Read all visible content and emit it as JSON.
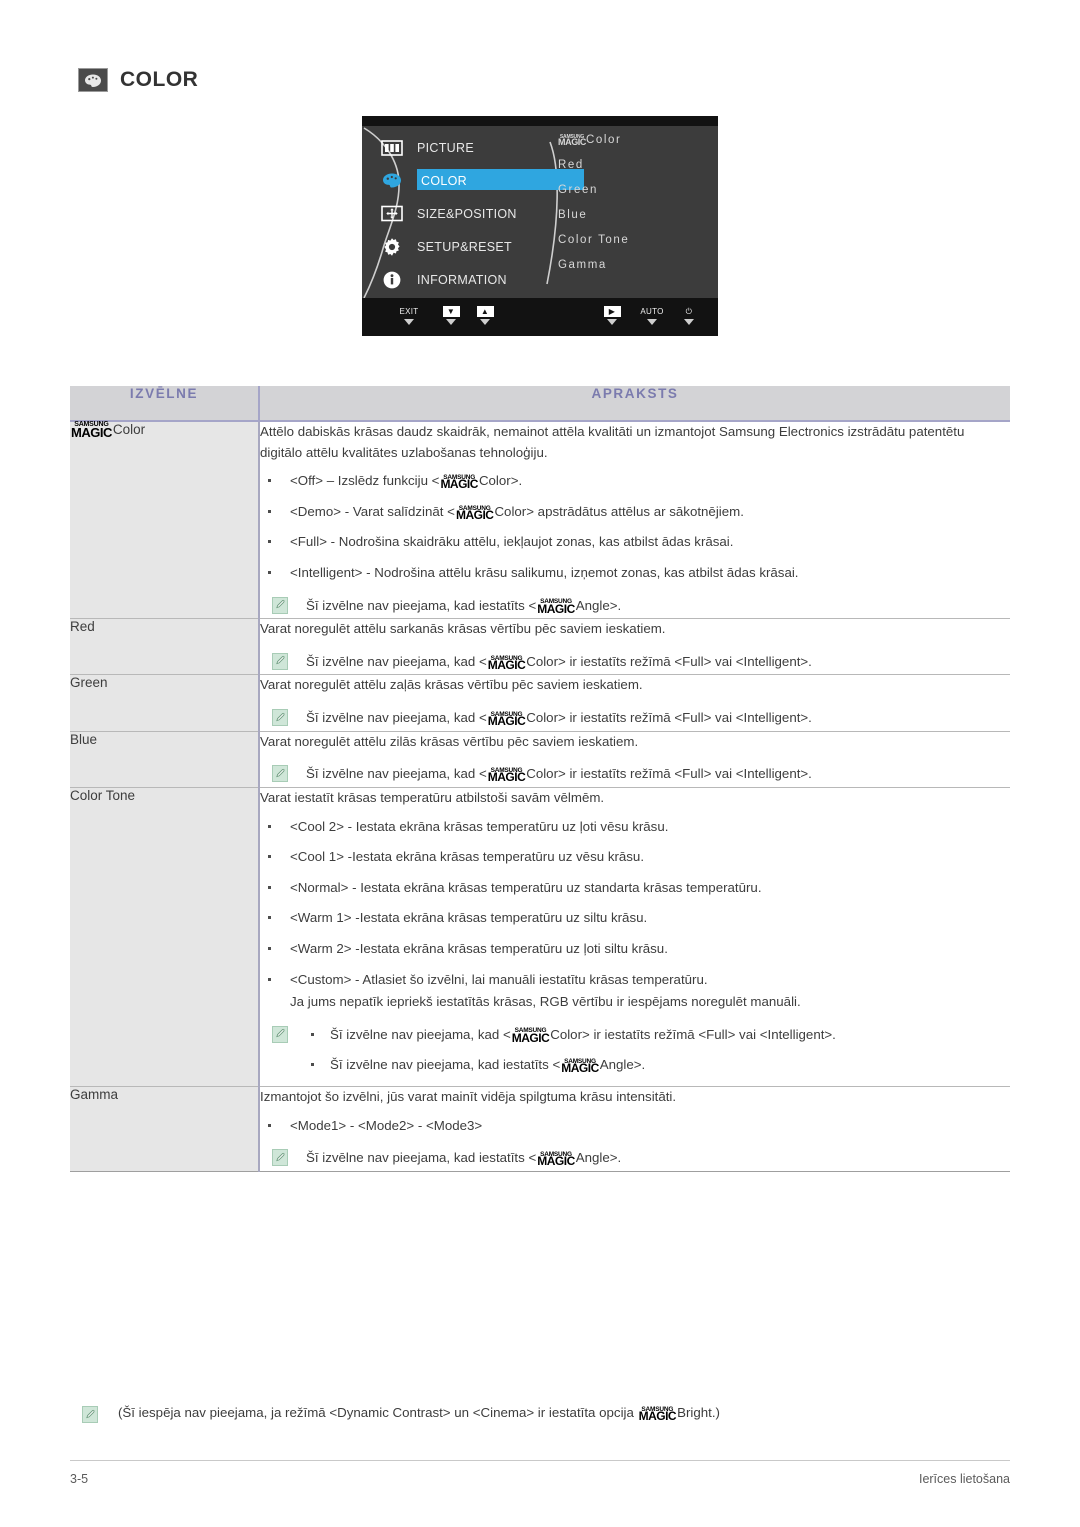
{
  "page": {
    "title": "COLOR",
    "title_icon": "color-palette-icon",
    "footer_page_number": "3-5",
    "footer_section": "Ierīces lietošana"
  },
  "osd": {
    "left_menu": [
      {
        "label": "PICTURE",
        "icon": "picture-icon",
        "selected": false
      },
      {
        "label": "COLOR",
        "icon": "color-palette-icon",
        "selected": true
      },
      {
        "label": "SIZE&POSITION",
        "icon": "size-position-icon",
        "selected": false
      },
      {
        "label": "SETUP&RESET",
        "icon": "gear-icon",
        "selected": false
      },
      {
        "label": "INFORMATION",
        "icon": "info-icon",
        "selected": false
      }
    ],
    "right_items": [
      {
        "prefix_logo": true,
        "label": "Color"
      },
      {
        "prefix_logo": false,
        "label": "Red"
      },
      {
        "prefix_logo": false,
        "label": "Green"
      },
      {
        "prefix_logo": false,
        "label": "Blue"
      },
      {
        "prefix_logo": false,
        "label": "Color Tone"
      },
      {
        "prefix_logo": false,
        "label": "Gamma"
      }
    ],
    "magic_logo": {
      "line1": "SAMSUNG",
      "line2": "MAGIC"
    },
    "bottom_buttons": [
      {
        "label": "EXIT",
        "type": "text"
      },
      {
        "label": "▼",
        "type": "key"
      },
      {
        "label": "▲",
        "type": "key"
      },
      {
        "label": "▶",
        "type": "key"
      },
      {
        "label": "AUTO",
        "type": "text"
      },
      {
        "label": "⏻",
        "type": "power"
      }
    ],
    "highlight_color": "#2fa6e0"
  },
  "table": {
    "header": {
      "menu": "IZVĒLNE",
      "desc": "APRAKSTS"
    },
    "header_text_color": "#7b7bae",
    "rows": [
      {
        "menu_label": "Color",
        "menu_has_logo": true,
        "desc_intro": "Attēlo dabiskās krāsas daudz skaidrāk, nemainot attēla kvalitāti un izmantojot Samsung Electronics izstrādātu patentētu digitālo attēlu kvalitātes uzlabošanas tehnoloģiju.",
        "bullets": [
          {
            "pre": "<Off> – Izslēdz funkciju <",
            "post": "Color>."
          },
          {
            "pre": "<Demo> - Varat salīdzināt <",
            "post": "Color> apstrādātus attēlus ar sākotnējiem."
          },
          {
            "pre": "<Full> - Nodrošina skaidrāku attēlu, iekļaujot zonas, kas atbilst ādas krāsai.",
            "post": ""
          },
          {
            "pre": "<Intelligent> - Nodrošina attēlu krāsu salikumu, izņemot zonas, kas atbilst ādas krāsai.",
            "post": ""
          }
        ],
        "note": {
          "pre": "Šī izvēlne nav pieejama, kad iestatīts <",
          "post": "Angle>."
        }
      },
      {
        "menu_label": "Red",
        "menu_has_logo": false,
        "desc_intro": "Varat noregulēt attēlu sarkanās krāsas vērtību pēc saviem ieskatiem.",
        "bullets": [],
        "note": {
          "pre": "Šī izvēlne nav pieejama, kad <",
          "post": "Color> ir iestatīts režīmā <Full> vai <Intelligent>."
        }
      },
      {
        "menu_label": "Green",
        "menu_has_logo": false,
        "desc_intro": "Varat noregulēt attēlu zaļās krāsas vērtību pēc saviem ieskatiem.",
        "bullets": [],
        "note": {
          "pre": "Šī izvēlne nav pieejama, kad <",
          "post": "Color> ir iestatīts režīmā <Full> vai <Intelligent>."
        }
      },
      {
        "menu_label": "Blue",
        "menu_has_logo": false,
        "desc_intro": "Varat noregulēt attēlu zilās krāsas vērtību pēc saviem ieskatiem.",
        "bullets": [],
        "note": {
          "pre": "Šī izvēlne nav pieejama, kad <",
          "post": "Color> ir iestatīts režīmā <Full> vai <Intelligent>."
        }
      },
      {
        "menu_label": "Color Tone",
        "menu_has_logo": false,
        "desc_intro": "Varat iestatīt krāsas temperatūru atbilstoši savām vēlmēm.",
        "bullets": [
          {
            "pre": "<Cool 2> - Iestata ekrāna krāsas temperatūru uz ļoti vēsu krāsu.",
            "post": ""
          },
          {
            "pre": "<Cool 1> -Iestata ekrāna krāsas temperatūru uz vēsu krāsu.",
            "post": ""
          },
          {
            "pre": "<Normal> - Iestata ekrāna krāsas temperatūru uz standarta krāsas temperatūru.",
            "post": ""
          },
          {
            "pre": "<Warm 1> -Iestata ekrāna krāsas temperatūru uz siltu krāsu.",
            "post": ""
          },
          {
            "pre": "<Warm 2> -Iestata ekrāna krāsas temperatūru uz ļoti siltu krāsu.",
            "post": ""
          },
          {
            "pre": "<Custom> - Atlasiet šo izvēlni, lai manuāli iestatītu krāsas temperatūru.",
            "post": "",
            "sub": "Ja jums nepatīk iepriekš iestatītās krāsas, RGB vērtību ir iespējams noregulēt manuāli."
          }
        ],
        "note_list": [
          {
            "pre": "Šī izvēlne nav pieejama, kad <",
            "post": "Color> ir iestatīts režīmā <Full> vai <Intelligent>."
          },
          {
            "pre": "Šī izvēlne nav pieejama, kad iestatīts <",
            "post": "Angle>."
          }
        ]
      },
      {
        "menu_label": "Gamma",
        "menu_has_logo": false,
        "desc_intro": "Izmantojot šo izvēlni, jūs varat mainīt vidēja spilgtuma krāsu intensitāti.",
        "bullets": [
          {
            "pre": "<Mode1> - <Mode2> - <Mode3>",
            "post": ""
          }
        ],
        "note": {
          "pre": "Šī izvēlne nav pieejama, kad iestatīts <",
          "post": "Angle>."
        }
      }
    ]
  },
  "footnote": {
    "pre": "(Šī iespēja nav pieejama, ja režīmā <Dynamic Contrast> un <Cinema> ir iestatīta opcija ",
    "post": "Bright.)"
  },
  "magic_logo": {
    "line1": "SAMSUNG",
    "line2": "MAGIC"
  }
}
